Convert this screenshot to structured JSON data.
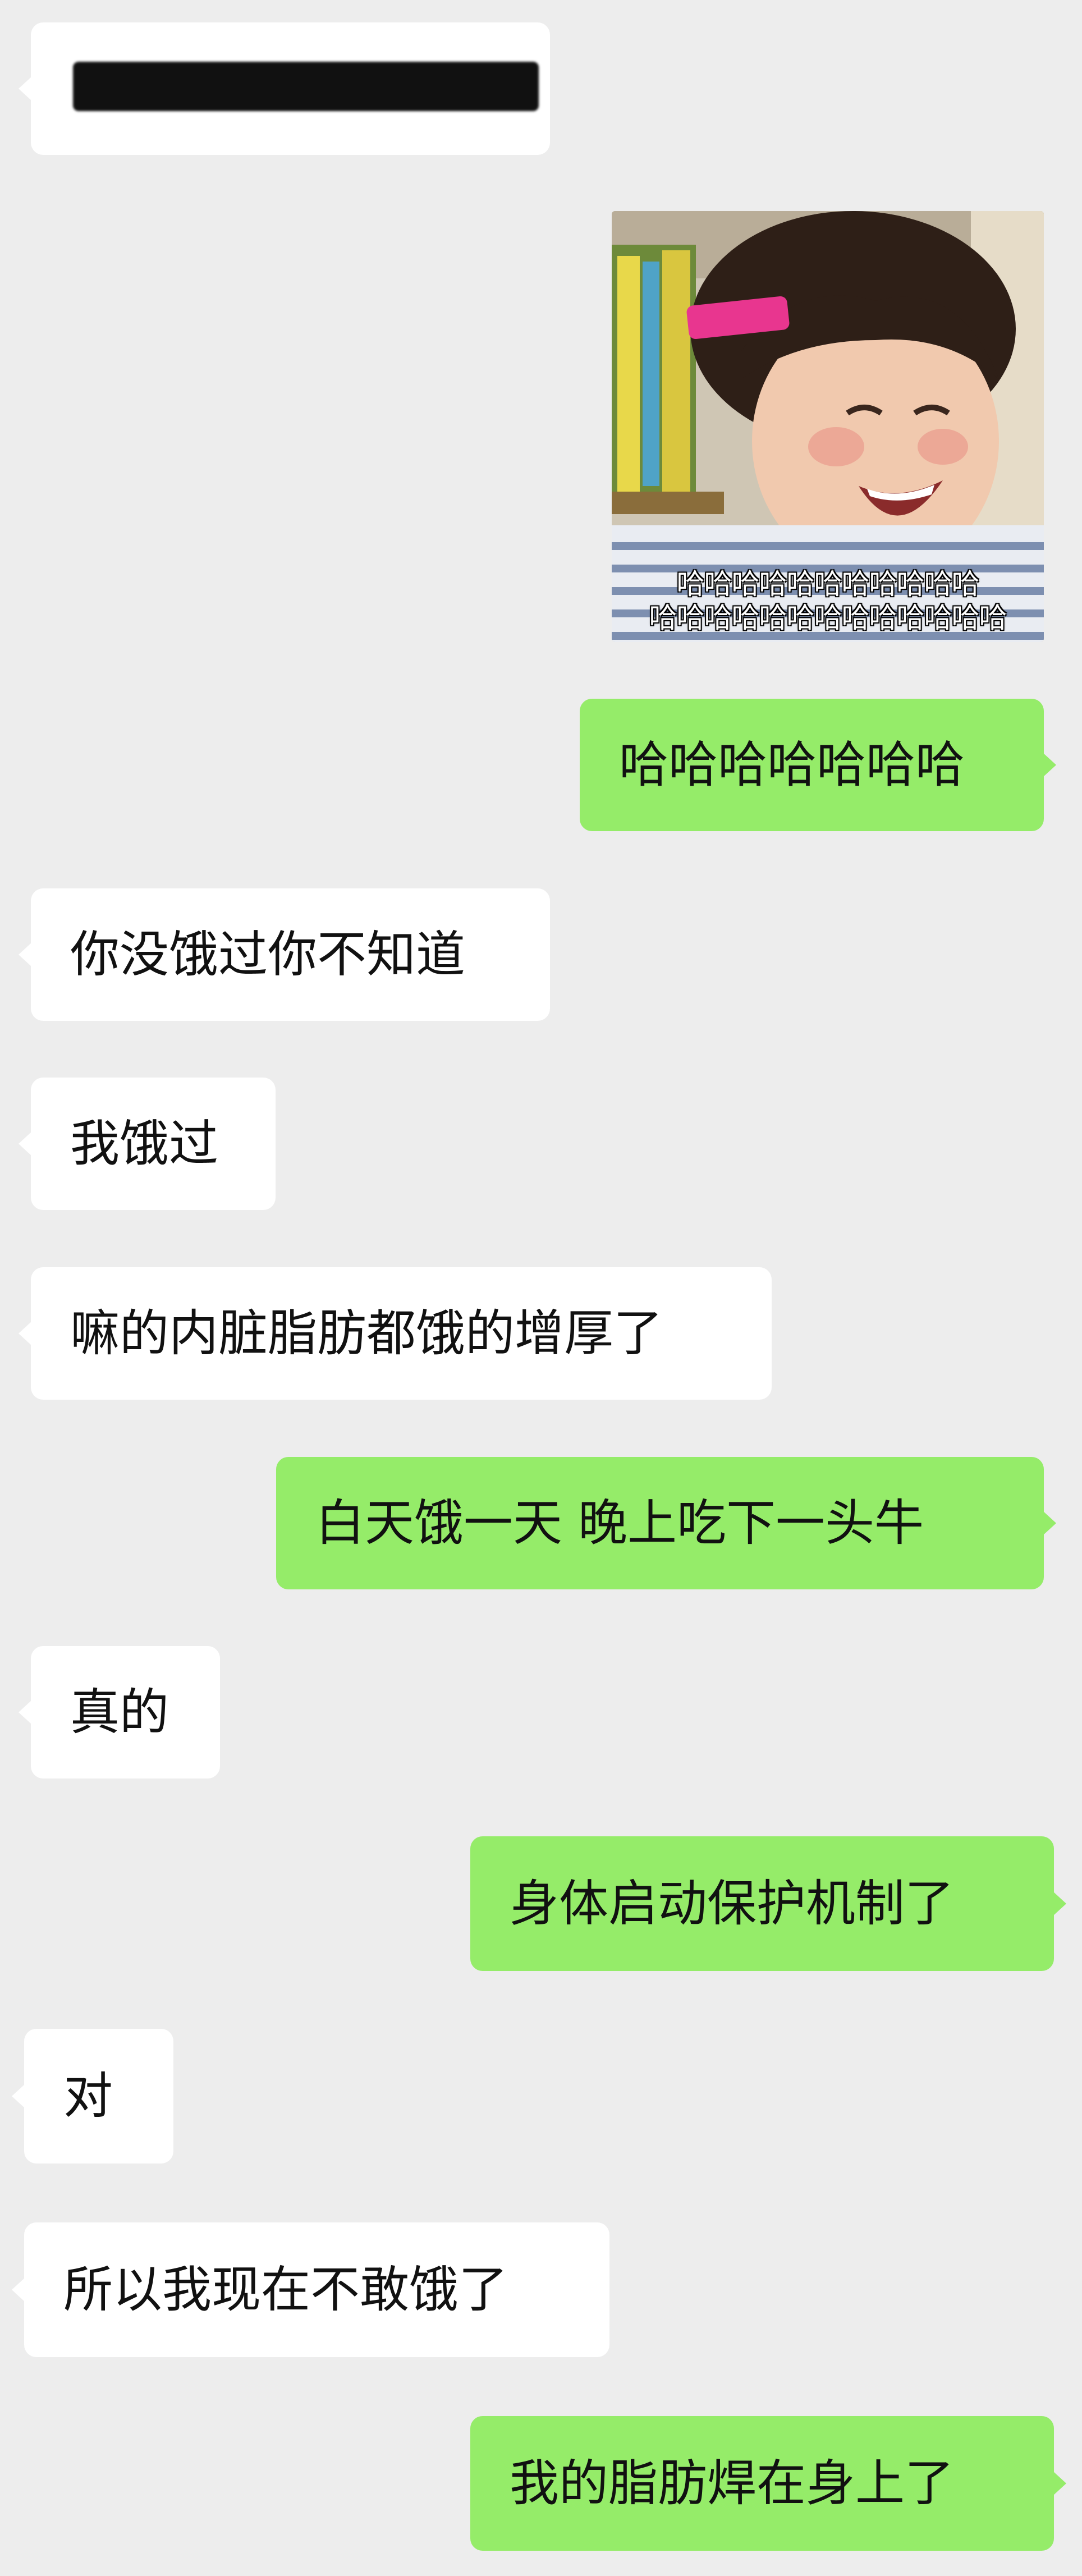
{
  "chat": {
    "messages": [
      {
        "side": "in",
        "text": "",
        "redacted": true
      },
      {
        "side": "out",
        "type": "sticker",
        "caption_line1": "哈哈哈哈哈哈哈哈哈哈哈",
        "caption_line2": "哈哈哈哈哈哈哈哈哈哈哈哈哈"
      },
      {
        "side": "out",
        "text": "哈哈哈哈哈哈哈"
      },
      {
        "side": "in",
        "text": "你没饿过你不知道"
      },
      {
        "side": "in",
        "text": "我饿过"
      },
      {
        "side": "in",
        "text": "嘛的内脏脂肪都饿的增厚了"
      },
      {
        "side": "out",
        "text": "白天饿一天  晚上吃下一头牛"
      },
      {
        "side": "in",
        "text": "真的"
      },
      {
        "side": "out",
        "text": "身体启动保护机制了"
      },
      {
        "side": "in",
        "text": "对"
      },
      {
        "side": "in",
        "text": "所以我现在不敢饿了"
      },
      {
        "side": "out",
        "text": "我的脂肪焊在身上了"
      }
    ]
  },
  "colors": {
    "background": "#ededed",
    "incoming_bubble": "#ffffff",
    "outgoing_bubble": "#95ec69",
    "text": "#111111"
  }
}
